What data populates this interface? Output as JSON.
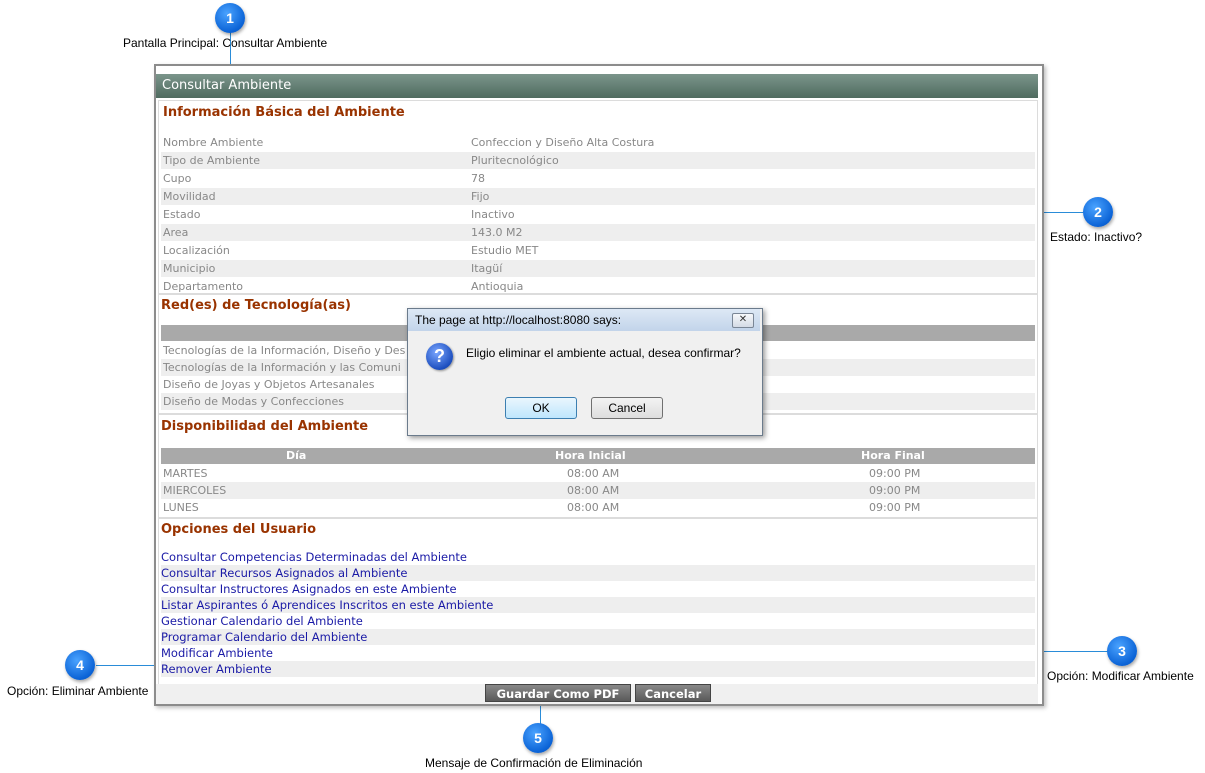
{
  "callouts": [
    {
      "num": "1",
      "text": "Pantalla Principal: Consultar Ambiente"
    },
    {
      "num": "2",
      "text": "Estado: Inactivo?"
    },
    {
      "num": "3",
      "text": "Opción: Modificar Ambiente"
    },
    {
      "num": "4",
      "text": "Opción: Eliminar Ambiente"
    },
    {
      "num": "5",
      "text": "Mensaje de Confirmación de Eliminación"
    }
  ],
  "window": {
    "title": "Consultar Ambiente"
  },
  "basic": {
    "title": "Información Básica del Ambiente",
    "rows": [
      {
        "label": "Nombre Ambiente",
        "value": "Confeccion y Diseño Alta Costura"
      },
      {
        "label": "Tipo de Ambiente",
        "value": "Pluritecnológico"
      },
      {
        "label": "Cupo",
        "value": "78"
      },
      {
        "label": "Movilidad",
        "value": "Fijo"
      },
      {
        "label": "Estado",
        "value": "Inactivo"
      },
      {
        "label": "Area",
        "value": "143.0 M2"
      },
      {
        "label": "Localización",
        "value": "Estudio MET"
      },
      {
        "label": "Municipio",
        "value": "Itagüí"
      },
      {
        "label": "Departamento",
        "value": "Antioquia"
      }
    ]
  },
  "networks": {
    "title": "Red(es) de Tecnología(as)",
    "items": [
      "Tecnologías de la Información, Diseño y Des",
      "Tecnologías de la Información y las Comuni",
      "Diseño de Joyas y Objetos Artesanales",
      "Diseño de Modas y Confecciones"
    ]
  },
  "availability": {
    "title": "Disponibilidad del Ambiente",
    "headers": [
      "Día",
      "Hora Inicial",
      "Hora Final"
    ],
    "rows": [
      [
        "MARTES",
        "08:00 AM",
        "09:00 PM"
      ],
      [
        "MIERCOLES",
        "08:00 AM",
        "09:00 PM"
      ],
      [
        "LUNES",
        "08:00 AM",
        "09:00 PM"
      ]
    ]
  },
  "options": {
    "title": "Opciones del Usuario",
    "links": [
      "Consultar Competencias Determinadas del Ambiente",
      "Consultar Recursos Asignados al Ambiente",
      "Consultar Instructores Asignados en este Ambiente",
      "Listar Aspirantes ó Aprendices Inscritos en este Ambiente",
      "Gestionar Calendario del Ambiente",
      "Programar Calendario del Ambiente",
      "Modificar Ambiente",
      "Remover Ambiente"
    ]
  },
  "footer": {
    "pdf_label": "Guardar Como PDF",
    "cancel_label": "Cancelar"
  },
  "dialog": {
    "title": "The page at http://localhost:8080 says:",
    "close_glyph": "✕",
    "icon_glyph": "?",
    "message": "Eligio eliminar el ambiente actual, desea confirmar?",
    "ok_label": "OK",
    "cancel_label": "Cancel"
  },
  "colors": {
    "section_title": "#993300",
    "link": "#1a1aa6",
    "callout": "#0b63d6"
  }
}
